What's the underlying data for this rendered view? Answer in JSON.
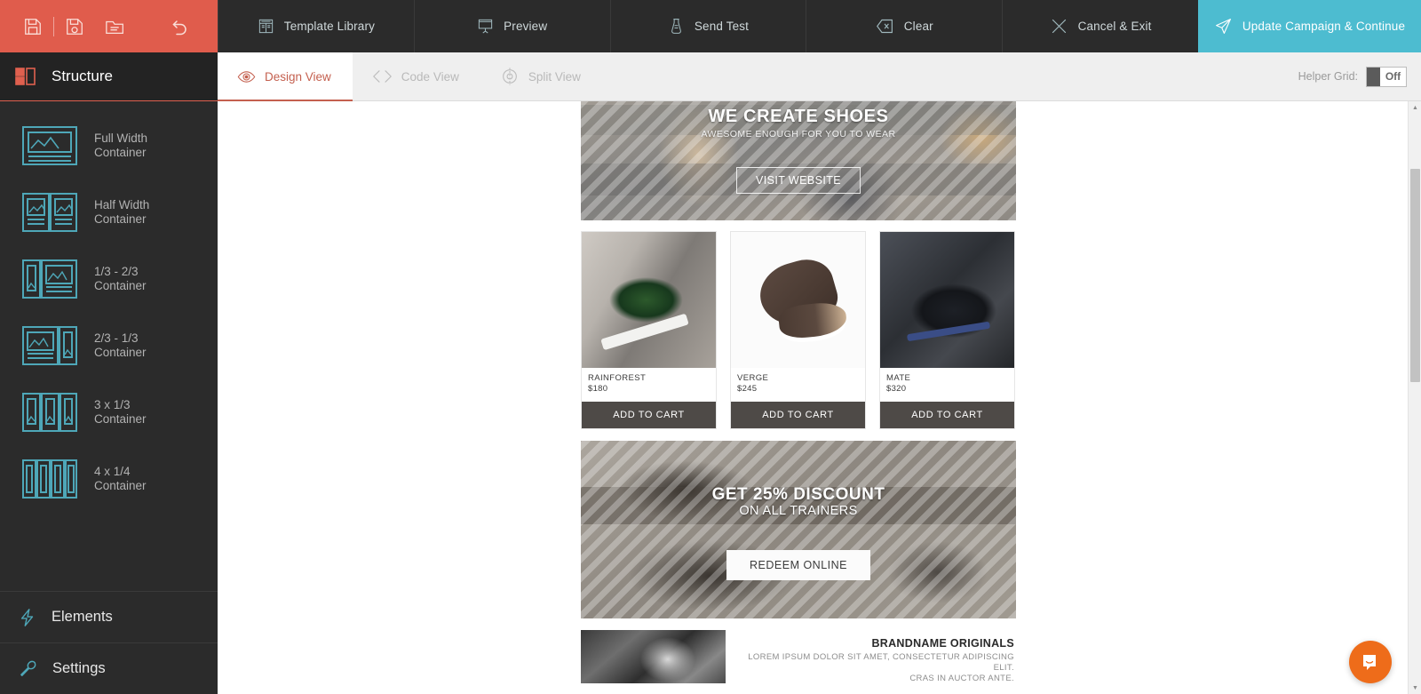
{
  "toolbar": {
    "left_icons": [
      {
        "name": "save-icon",
        "label": "Save"
      },
      {
        "name": "save-as-icon",
        "label": "Save As"
      },
      {
        "name": "open-folder-icon",
        "label": "Open"
      },
      {
        "name": "undo-icon",
        "label": "Undo"
      }
    ],
    "items": [
      {
        "label": "Template Library",
        "icon": "template-library-icon"
      },
      {
        "label": "Preview",
        "icon": "preview-icon"
      },
      {
        "label": "Send Test",
        "icon": "send-test-icon"
      },
      {
        "label": "Clear",
        "icon": "clear-icon"
      },
      {
        "label": "Cancel & Exit",
        "icon": "cancel-exit-icon"
      }
    ],
    "primary_action": {
      "label": "Update Campaign & Continue",
      "icon": "send-plane-icon"
    },
    "accent_color": "#4dbcd0",
    "left_bg_color": "#e05c4c",
    "bar_bg_color": "#2b2b2b"
  },
  "viewbar": {
    "tabs": [
      {
        "label": "Design View",
        "icon": "eye-icon",
        "active": true
      },
      {
        "label": "Code View",
        "icon": "code-brackets-icon",
        "active": false
      },
      {
        "label": "Split View",
        "icon": "split-view-icon",
        "active": false
      }
    ],
    "helper_grid_label": "Helper Grid:",
    "helper_grid_value": "Off",
    "active_color": "#c4604f"
  },
  "sidebar": {
    "title": "Structure",
    "title_icon": "structure-icon",
    "items": [
      {
        "label_line1": "Full Width",
        "label_line2": "Container",
        "icon": "full-width-container-icon"
      },
      {
        "label_line1": "Half Width",
        "label_line2": "Container",
        "icon": "half-width-container-icon"
      },
      {
        "label_line1": "1/3 - 2/3",
        "label_line2": "Container",
        "icon": "one-third-two-third-container-icon"
      },
      {
        "label_line1": "2/3 - 1/3",
        "label_line2": "Container",
        "icon": "two-third-one-third-container-icon"
      },
      {
        "label_line1": "3 x 1/3",
        "label_line2": "Container",
        "icon": "three-by-one-third-container-icon"
      },
      {
        "label_line1": "4 x 1/4",
        "label_line2": "Container",
        "icon": "four-by-one-quarter-container-icon"
      }
    ],
    "bottom": [
      {
        "label": "Elements",
        "icon": "lightning-bolt-icon"
      },
      {
        "label": "Settings",
        "icon": "wrench-icon"
      }
    ],
    "accent_color": "#4ea7b8",
    "bg_color": "#2b2b2b"
  },
  "email": {
    "hero": {
      "title": "WE CREATE SHOES",
      "subtitle": "AWESOME ENOUGH FOR YOU TO WEAR",
      "button": "VISIT WEBSITE"
    },
    "products": [
      {
        "name": "RAINFOREST",
        "price": "$180",
        "button": "ADD TO CART"
      },
      {
        "name": "VERGE",
        "price": "$245",
        "button": "ADD TO CART"
      },
      {
        "name": "MATE",
        "price": "$320",
        "button": "ADD TO CART"
      }
    ],
    "discount": {
      "title": "GET 25% DISCOUNT",
      "subtitle": "ON ALL TRAINERS",
      "button": "REDEEM ONLINE"
    },
    "footer": {
      "title": "BRANDNAME ORIGINALS",
      "body_line1": "LOREM IPSUM DOLOR SIT AMET, CONSECTETUR ADIPISCING ELIT.",
      "body_line2": "CRAS IN AUCTOR ANTE."
    }
  },
  "chat": {
    "icon": "chat-bubble-icon",
    "color": "#ee6c1a"
  },
  "scroll": {
    "up_arrow": "▲",
    "down_arrow": "▼"
  }
}
